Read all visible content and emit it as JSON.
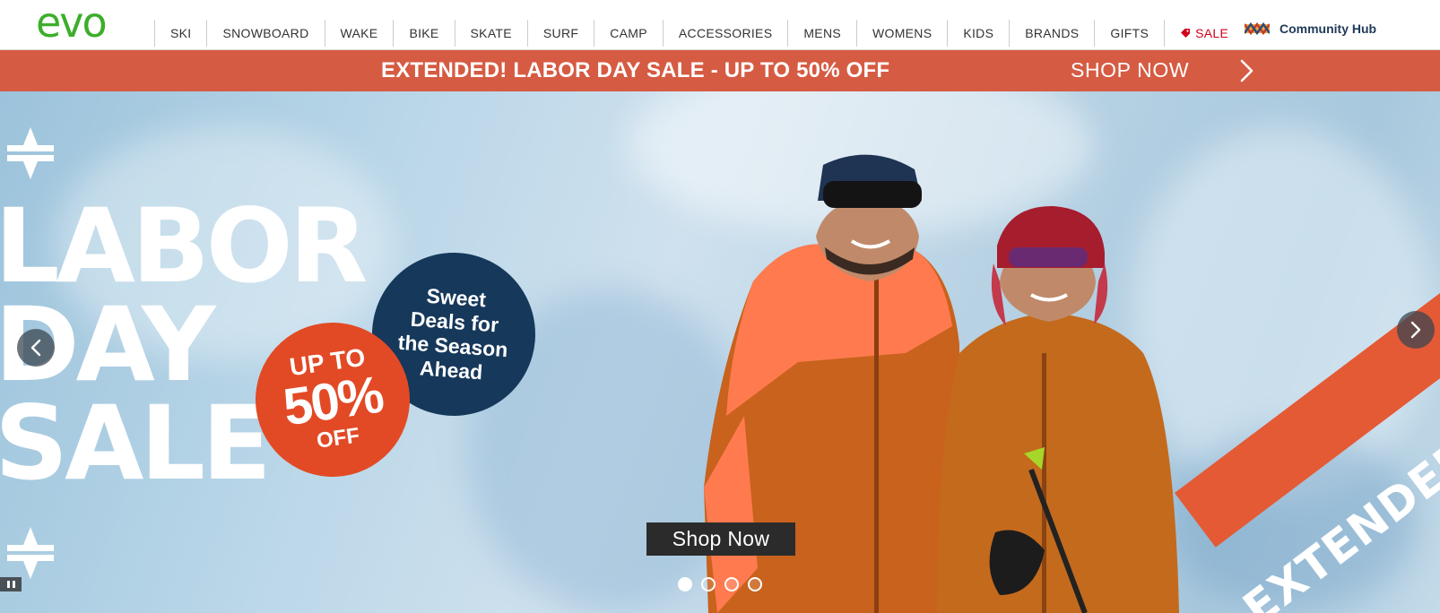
{
  "brand": {
    "logo_text": "evo",
    "logo_color": "#3dae2b"
  },
  "nav": {
    "items": [
      {
        "label": "SKI"
      },
      {
        "label": "SNOWBOARD"
      },
      {
        "label": "WAKE"
      },
      {
        "label": "BIKE"
      },
      {
        "label": "SKATE"
      },
      {
        "label": "SURF"
      },
      {
        "label": "CAMP"
      },
      {
        "label": "ACCESSORIES"
      },
      {
        "label": "MENS"
      },
      {
        "label": "WOMENS"
      },
      {
        "label": "KIDS"
      },
      {
        "label": "BRANDS"
      },
      {
        "label": "GIFTS"
      }
    ],
    "sale": {
      "label": "SALE",
      "icon": "price-tag-icon",
      "color": "#d0021b"
    },
    "community": {
      "label": "Community Hub",
      "icon": "community-hub-icon"
    }
  },
  "promo_banner": {
    "text": "EXTENDED! LABOR DAY SALE - UP TO 50% OFF",
    "cta": "SHOP NOW",
    "icon": "chevron-right-icon",
    "background": "#d65b43"
  },
  "hero": {
    "title_lines": [
      "LABOR",
      "DAY",
      "SALE"
    ],
    "deal_badge_lines": [
      "Sweet",
      "Deals for",
      "the Season",
      "Ahead"
    ],
    "discount_badge": {
      "line1": "UP TO",
      "line2": "50%",
      "line3": "OFF"
    },
    "corner_banner": "EXTENDED",
    "cta": "Shop Now",
    "prev_icon": "chevron-left-icon",
    "next_icon": "chevron-right-icon",
    "pause_icon": "pause-icon",
    "slides": {
      "count": 4,
      "active_index": 0
    },
    "colors": {
      "deal_badge": "#16385a",
      "discount_badge": "#e24a26",
      "corner_banner": "#e45a35"
    }
  }
}
